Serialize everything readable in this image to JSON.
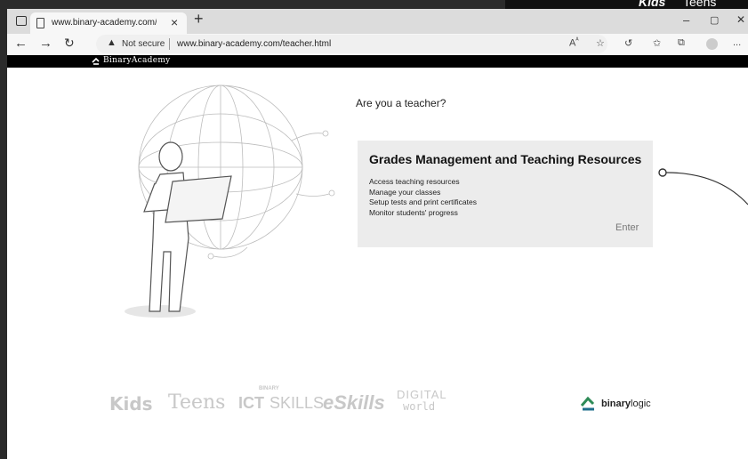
{
  "browser": {
    "tab_title": "www.binary-academy.com/teach",
    "tab_close": "×",
    "new_tab": "+",
    "window_controls": [
      "–",
      "▢",
      "✕"
    ],
    "security_label": "Not secure",
    "url": "www.binary-academy.com/teacher.html",
    "toolbar_icons": [
      "read-aloud-icon",
      "favorites-add-icon",
      "refresh-extensions-icon",
      "favorites-icon",
      "collections-icon",
      "profile-icon",
      "more-icon"
    ],
    "more_label": "..."
  },
  "promo_banner": {
    "words": [
      "Kids",
      "Teens"
    ]
  },
  "site": {
    "brand": "BinaryAcademy"
  },
  "main": {
    "question": "Are you a teacher?",
    "card": {
      "title": "Grades Management and Teaching Resources",
      "items": [
        "Access teaching resources",
        "Manage your classes",
        "Setup tests and print certificates",
        "Monitor students' progress"
      ],
      "enter_label": "Enter"
    }
  },
  "footer": {
    "logos": {
      "kids": "Kids",
      "teens": "Teens",
      "ict_small": "BINARY",
      "ict_bold": "ICT",
      "ict_light": "SKILLS",
      "eskills": "eSkills",
      "digital_top": "DIGITAL",
      "digital_bottom": "world"
    },
    "binarylogic": {
      "bold": "binary",
      "light": "logic"
    }
  },
  "colors": {
    "accent": "#2e8b57",
    "card_bg": "#ececec",
    "sitebar": "#000000"
  }
}
